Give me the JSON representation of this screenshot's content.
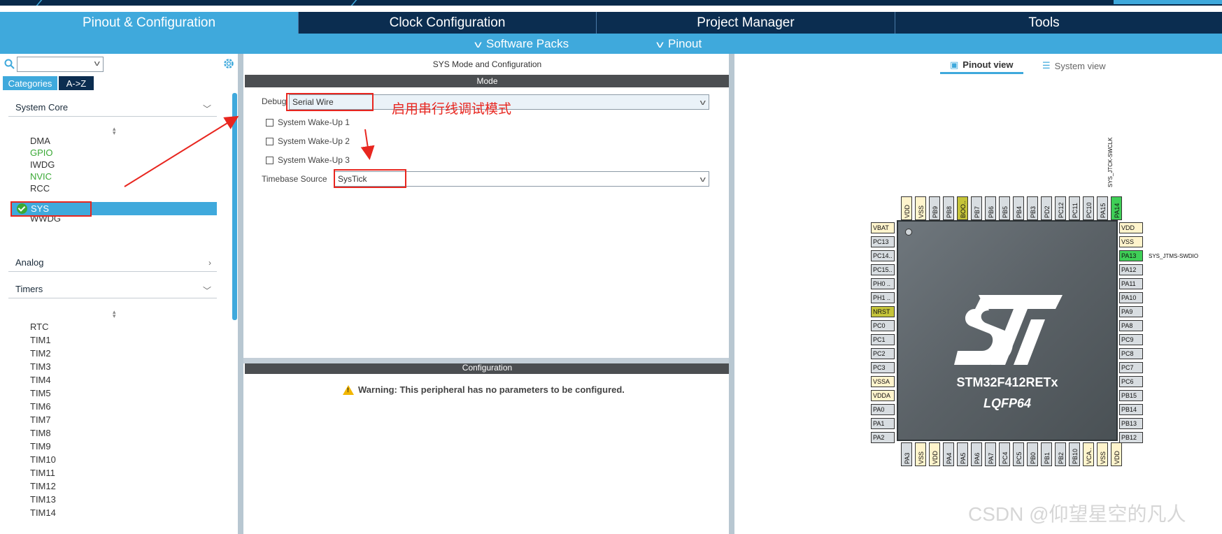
{
  "tabs": [
    {
      "label": "Pinout & Configuration",
      "active": true
    },
    {
      "label": "Clock Configuration",
      "active": false
    },
    {
      "label": "Project Manager",
      "active": false
    },
    {
      "label": "Tools",
      "active": false
    }
  ],
  "subbar": {
    "software_packs": "Software Packs",
    "pinout": "Pinout"
  },
  "left": {
    "search_value": "",
    "segments": {
      "categories": "Categories",
      "az": "A->Z"
    },
    "system_core": {
      "title": "System Core",
      "items": [
        "DMA",
        "GPIO",
        "IWDG",
        "NVIC",
        "RCC",
        "SYS",
        "WWDG"
      ],
      "selected": "SYS"
    },
    "analog": {
      "title": "Analog"
    },
    "timers": {
      "title": "Timers",
      "items": [
        "RTC",
        "TIM1",
        "TIM2",
        "TIM3",
        "TIM4",
        "TIM5",
        "TIM6",
        "TIM7",
        "TIM8",
        "TIM9",
        "TIM10",
        "TIM11",
        "TIM12",
        "TIM13",
        "TIM14"
      ]
    }
  },
  "middle": {
    "header": "SYS Mode and Configuration",
    "mode_bar": "Mode",
    "debug_label": "Debug",
    "debug_value": "Serial Wire",
    "wakeups": [
      "System Wake-Up 1",
      "System Wake-Up 2",
      "System Wake-Up 3"
    ],
    "timebase_label": "Timebase Source",
    "timebase_value": "SysTick",
    "config_bar": "Configuration",
    "warning": "Warning: This peripheral has no parameters to be configured.",
    "annotation": "启用串行线调试模式"
  },
  "right": {
    "pinout_view": "Pinout view",
    "system_view": "System view",
    "chip": {
      "name": "STM32F412RETx",
      "package": "LQFP64"
    },
    "pins_top": [
      "VDD",
      "VSS",
      "PB9",
      "PB8",
      "BOO..",
      "PB7",
      "PB6",
      "PB5",
      "PB4",
      "PB3",
      "PD2",
      "PC12",
      "PC11",
      "PC10",
      "PA15",
      "PA14"
    ],
    "pins_left": [
      "VBAT",
      "PC13",
      "PC14..",
      "PC15..",
      "PH0 ..",
      "PH1 ..",
      "NRST",
      "PC0",
      "PC1",
      "PC2",
      "PC3",
      "VSSA",
      "VDDA",
      "PA0",
      "PA1",
      "PA2"
    ],
    "pins_right": [
      "VDD",
      "VSS",
      "PA13",
      "PA12",
      "PA11",
      "PA10",
      "PA9",
      "PA8",
      "PC9",
      "PC8",
      "PC7",
      "PC6",
      "PB15",
      "PB14",
      "PB13",
      "PB12"
    ],
    "pins_bottom": [
      "PA3",
      "VSS",
      "VDD",
      "PA4",
      "PA5",
      "PA6",
      "PA7",
      "PC4",
      "PC5",
      "PB0",
      "PB1",
      "PB2",
      "PB10",
      "VCA..",
      "VSS",
      "VDD"
    ],
    "signal_top": "SYS_JTCK-SWCLK",
    "signal_right": "SYS_JTMS-SWDIO"
  },
  "watermark": "CSDN @仰望星空的凡人"
}
